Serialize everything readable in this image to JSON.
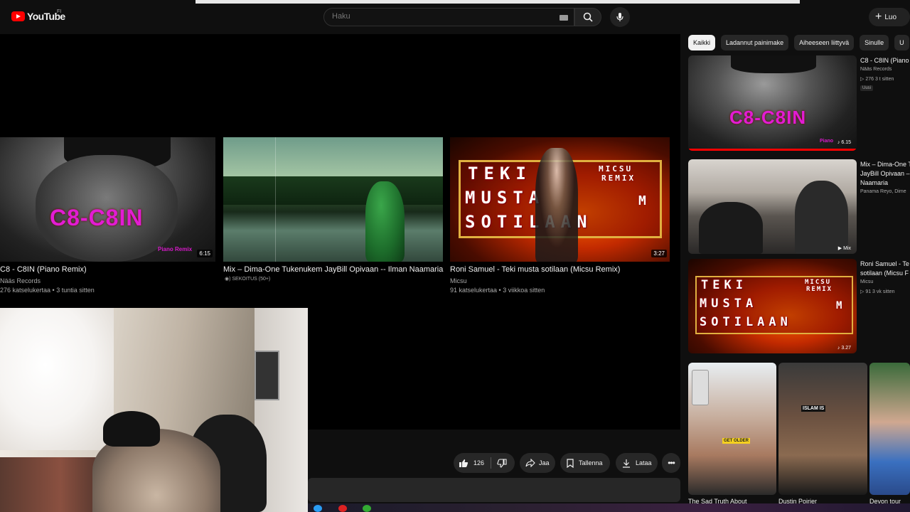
{
  "header": {
    "logo_text": "YouTube",
    "country_code": "FI",
    "search_placeholder": "Haku",
    "create_label": "Luo"
  },
  "endscreen": [
    {
      "title": "C8 - C8IN (Piano Remix)",
      "channel": "Nääs Records",
      "stats": "276 katselukertaa • 3 tuntia sitten",
      "duration": "6:15",
      "overlay_text": "C8-C8IN",
      "overlay_sub": "Piano Remix"
    },
    {
      "title": "Mix – Dima-One Tukenukem JayBill Opivaan -- Ilman Naamaria",
      "channel": "SEKOITUS (50+)",
      "stats": "",
      "duration": ""
    },
    {
      "title": "Roni Samuel - Teki musta sotilaan (Micsu Remix)",
      "channel": "Micsu",
      "stats": "91 katselukertaa • 3 viikkoa sitten",
      "duration": "3:27",
      "overlay_lines": [
        "TEKI",
        "MUSTA",
        "SOTILAAN"
      ],
      "overlay_remix": [
        "MICSU",
        "REMIX"
      ],
      "overlay_mark": "M"
    }
  ],
  "actions": {
    "likes": "126",
    "share": "Jaa",
    "save": "Tallenna",
    "download": "Lataa"
  },
  "sidebar": {
    "chips": [
      "Kaikki",
      "Ladannut painimake",
      "Aiheeseen liittyvä",
      "Sinulle",
      "U"
    ],
    "active_chip": "Kaikki",
    "items": [
      {
        "title": "C8 - C8IN (Piano",
        "channel": "Nääs Records",
        "stats": "▷ 276  3 t sitten",
        "badge": "Uusi",
        "duration": "♪ 6.15",
        "overlay_text": "C8-C8IN",
        "overlay_sub": "Piano"
      },
      {
        "title_lines": [
          "Mix – Dima-One T",
          "JayBill Opivaan –",
          "Naamaria"
        ],
        "channel": "Panama Reyo, Dime",
        "duration": "▶ Mix"
      },
      {
        "title_lines": [
          "Roni Samuel - Te",
          "sotilaan (Micsu F"
        ],
        "channel": "Micsu",
        "stats": "▷ 91  3 vk sitten",
        "duration": "♪ 3.27",
        "overlay_lines": [
          "TEKI",
          "MUSTA",
          "SOTILAAN"
        ],
        "overlay_remix": [
          "MICSU",
          "REMIX"
        ],
        "overlay_mark": "M"
      }
    ]
  },
  "shorts": [
    {
      "title": "The Sad Truth About",
      "badge": "GET OLDER"
    },
    {
      "title": "Dustin Poirier",
      "badge": "ISLAM IS"
    },
    {
      "title": "Devon tour"
    }
  ],
  "colors": {
    "background": "#0f0f0f",
    "brand_red": "#ff0000",
    "chip_bg": "#272727",
    "overlay_magenta": "#e21cd4"
  }
}
